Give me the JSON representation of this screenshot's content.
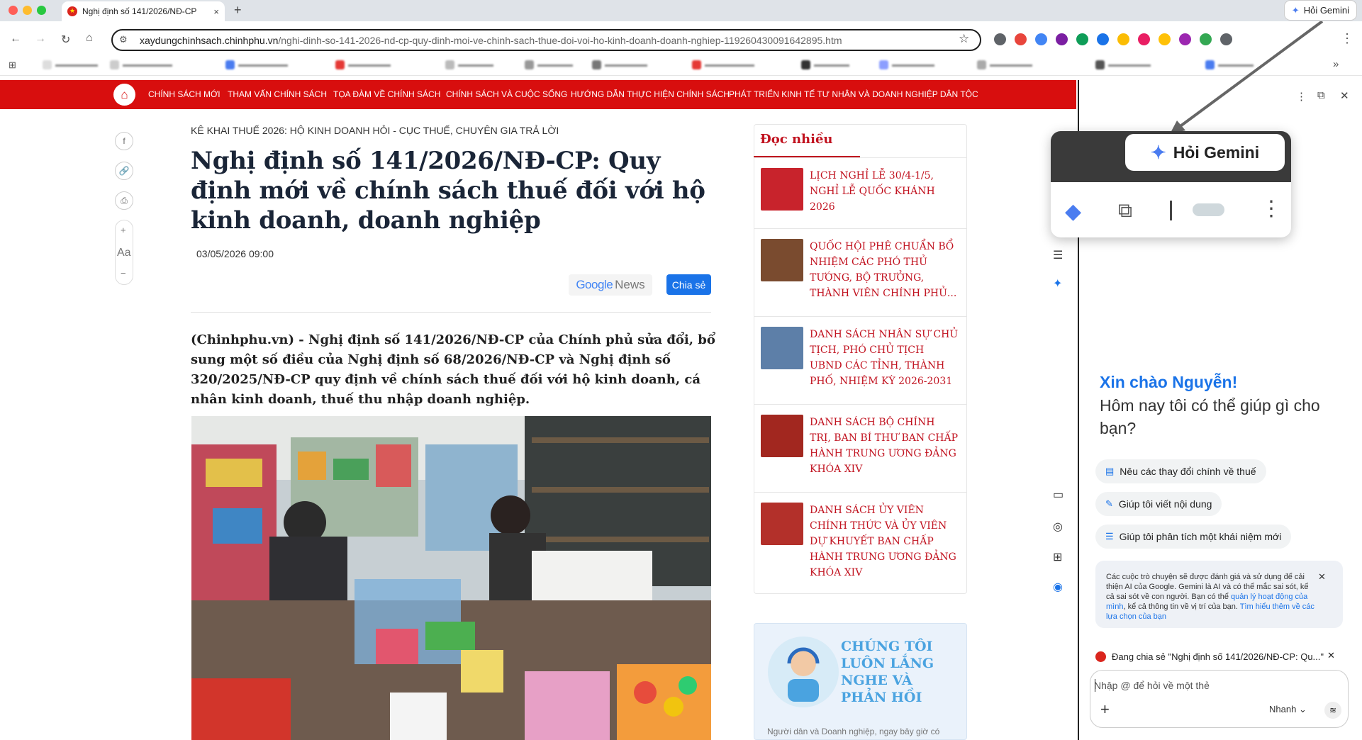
{
  "browser": {
    "tab_title": "Nghị định số 141/2026/NĐ-CP",
    "tab_close": "×",
    "new_tab": "+",
    "gemini_button": "Hỏi Gemini",
    "url_host": "xaydungchinhsach.chinhphu.vn",
    "url_path": "/nghi-dinh-so-141-2026-nd-cp-quy-dinh-moi-ve-chinh-sach-thue-doi-voi-ho-kinh-doanh-doanh-nghiep-119260430091642895.htm",
    "nav_icons": [
      "back-icon",
      "forward-icon",
      "reload-icon",
      "home-icon"
    ],
    "extension_colors": [
      "#5f6368",
      "#e8453c",
      "#4285f4",
      "#7b1fa2",
      "#0f9d58",
      "#1a73e8",
      "#fbbc04",
      "#e91e63",
      "#ffc107",
      "#9c27b0",
      "#34a853",
      "#5f6368"
    ],
    "bookmarks_more": "»"
  },
  "site": {
    "brand_color": "#d80e0e",
    "nav": [
      "CHÍNH SÁCH MỚI",
      "THAM VẤN CHÍNH SÁCH",
      "TỌA ĐÀM VỀ CHÍNH SÁCH",
      "CHÍNH SÁCH VÀ CUỘC SỐNG",
      "HƯỚNG DẪN THỰC HIỆN CHÍNH SÁCH",
      "PHÁT TRIỂN KINH TẾ TƯ NHÂN VÀ DOANH NGHIỆP DÂN TỘC"
    ],
    "rail": {
      "font_label": "Aa",
      "plus": "+",
      "minus": "−"
    }
  },
  "article": {
    "kicker": "KÊ KHAI THUẾ 2026: HỘ KINH DOANH HỎI - CỤC THUẾ, CHUYÊN GIA TRẢ LỜI",
    "headline": "Nghị định số 141/2026/NĐ-CP: Quy định mới về chính sách thuế đối với hộ kinh doanh, doanh nghiệp",
    "date": "03/05/2026 09:00",
    "gnews_label_g": "Google",
    "gnews_label_n": "News",
    "share_label": "Chia sẻ",
    "lead": "(Chinhphu.vn) - Nghị định số 141/2026/NĐ-CP của Chính phủ sửa đổi, bổ sung một số điều của Nghị định số 68/2026/NĐ-CP và Nghị định số 320/2025/NĐ-CP quy định về chính sách thuế đối với hộ kinh doanh, cá nhân kinh doanh, thuế thu nhập doanh nghiệp."
  },
  "sidebar": {
    "title": "Đọc nhiều",
    "items": [
      {
        "text": "LỊCH NGHỈ LỄ 30/4-1/5, NGHỈ LỄ QUỐC KHÁNH 2026"
      },
      {
        "text": "QUỐC HỘI PHÊ CHUẨN BỔ NHIỆM CÁC PHÓ THỦ TƯỚNG, BỘ TRƯỞNG, THÀNH VIÊN CHÍNH PHỦ..."
      },
      {
        "text": "DANH SÁCH NHÂN SỰ CHỦ TỊCH, PHÓ CHỦ TỊCH UBND CÁC TỈNH, THÀNH PHỐ, NHIỆM KỲ 2026-2031"
      },
      {
        "text": "DANH SÁCH BỘ CHÍNH TRỊ, BAN BÍ THƯ BAN CHẤP HÀNH TRUNG ƯƠNG ĐẢNG KHÓA XIV"
      },
      {
        "text": "DANH SÁCH ỦY VIÊN CHÍNH THỨC VÀ ỦY VIÊN DỰ KHUYẾT BAN CHẤP HÀNH TRUNG ƯƠNG ĐẢNG KHÓA XIV"
      }
    ],
    "feedback_title": "CHÚNG TÔI LUÔN LẮNG NGHE VÀ PHẢN HỒI",
    "feedback_sub": "Người dân và Doanh nghiệp, ngay bây giờ có"
  },
  "gemini": {
    "popup_label": "Hỏi Gemini",
    "greeting_name": "Xin chào Nguyễn!",
    "greeting_question": "Hôm nay tôi có thể giúp gì cho bạn?",
    "chips": [
      "Nêu các thay đổi chính về thuế",
      "Giúp tôi viết nội dung",
      "Giúp tôi phân tích một khái niệm mới"
    ],
    "notice_text": "Các cuộc trò chuyện sẽ được đánh giá và sử dụng để cải thiện AI của Google. Gemini là AI và có thể mắc sai sót, kể cả sai sót về con người. Bạn có thể",
    "notice_link1": "quản lý hoạt động của mình",
    "notice_mid": ", kể cả thông tin về vị trí của bạn.",
    "notice_link2": "Tìm hiểu thêm về các lựa chọn của bạn",
    "sharing_text": "Đang chia sẻ \"Nghị định số 141/2026/NĐ-CP: Qu...\"",
    "input_placeholder": "Nhập @ để hỏi về một thẻ",
    "mode_label": "Nhanh",
    "accent": "#1a73e8"
  }
}
